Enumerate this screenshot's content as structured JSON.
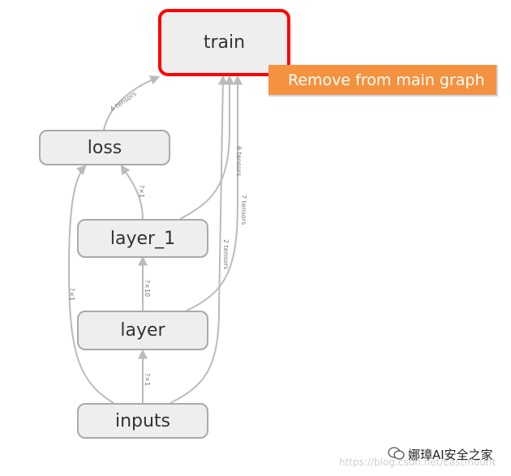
{
  "nodes": {
    "train": "train",
    "loss": "loss",
    "layer_1": "layer_1",
    "layer": "layer",
    "inputs": "inputs"
  },
  "context_menu": {
    "remove_label": "Remove from main graph"
  },
  "edge_labels": {
    "loss_train": "4 tensors",
    "layer1_loss": "?×1",
    "layer1_train": "6 tensors",
    "layer_train": "7 tensors",
    "inputs_train": "2 tensors",
    "layer_layer1": "?×10",
    "inputs_layer": "?×1",
    "inputs_loss": "?×1"
  },
  "watermark": {
    "text": "娜璋AI安全之家",
    "url": "https://blog.csdn.net/Eastmount"
  },
  "colors": {
    "selected_border": "#ff0000",
    "menu_bg": "#f4923f",
    "node_bg": "#eeeeee",
    "edge": "#bbbbbb"
  }
}
